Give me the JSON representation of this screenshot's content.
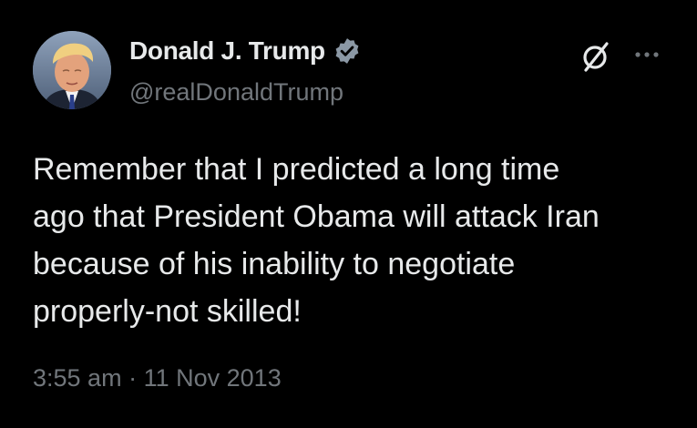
{
  "author": {
    "display_name": "Donald J. Trump",
    "handle": "@realDonaldTrump",
    "verified": true,
    "verified_badge_color": "#8b98a5"
  },
  "icons": {
    "avatar": "profile-photo",
    "verified": "verified-badge-icon",
    "grok": "grok-icon",
    "more": "more-options-icon"
  },
  "tweet": {
    "text": "Remember that I predicted a long time\nago that President Obama will attack Iran\nbecause of his inability to negotiate\nproperly-not skilled!",
    "time": "3:55 am",
    "separator": "·",
    "date": "11 Nov 2013"
  },
  "colors": {
    "background": "#000000",
    "primary_text": "#e7e9ea",
    "secondary_text": "#71767b"
  }
}
